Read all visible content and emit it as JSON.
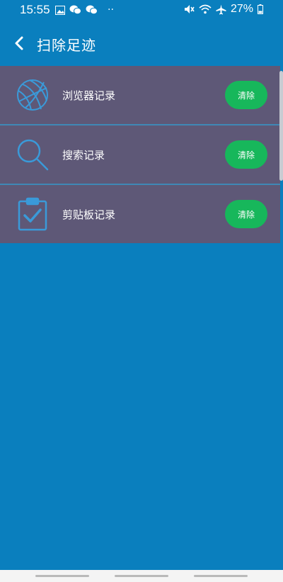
{
  "status_bar": {
    "time": "15:55",
    "dots": "··",
    "battery": "27%"
  },
  "header": {
    "title": "扫除足迹"
  },
  "items": [
    {
      "label": "浏览器记录",
      "button": "清除",
      "icon": "globe-icon"
    },
    {
      "label": "搜索记录",
      "button": "清除",
      "icon": "search-icon"
    },
    {
      "label": "剪贴板记录",
      "button": "清除",
      "icon": "clipboard-check-icon"
    }
  ],
  "colors": {
    "background": "#0a7fbe",
    "row": "#5e5877",
    "icon": "#3a9ad9",
    "button": "#17b75b"
  }
}
